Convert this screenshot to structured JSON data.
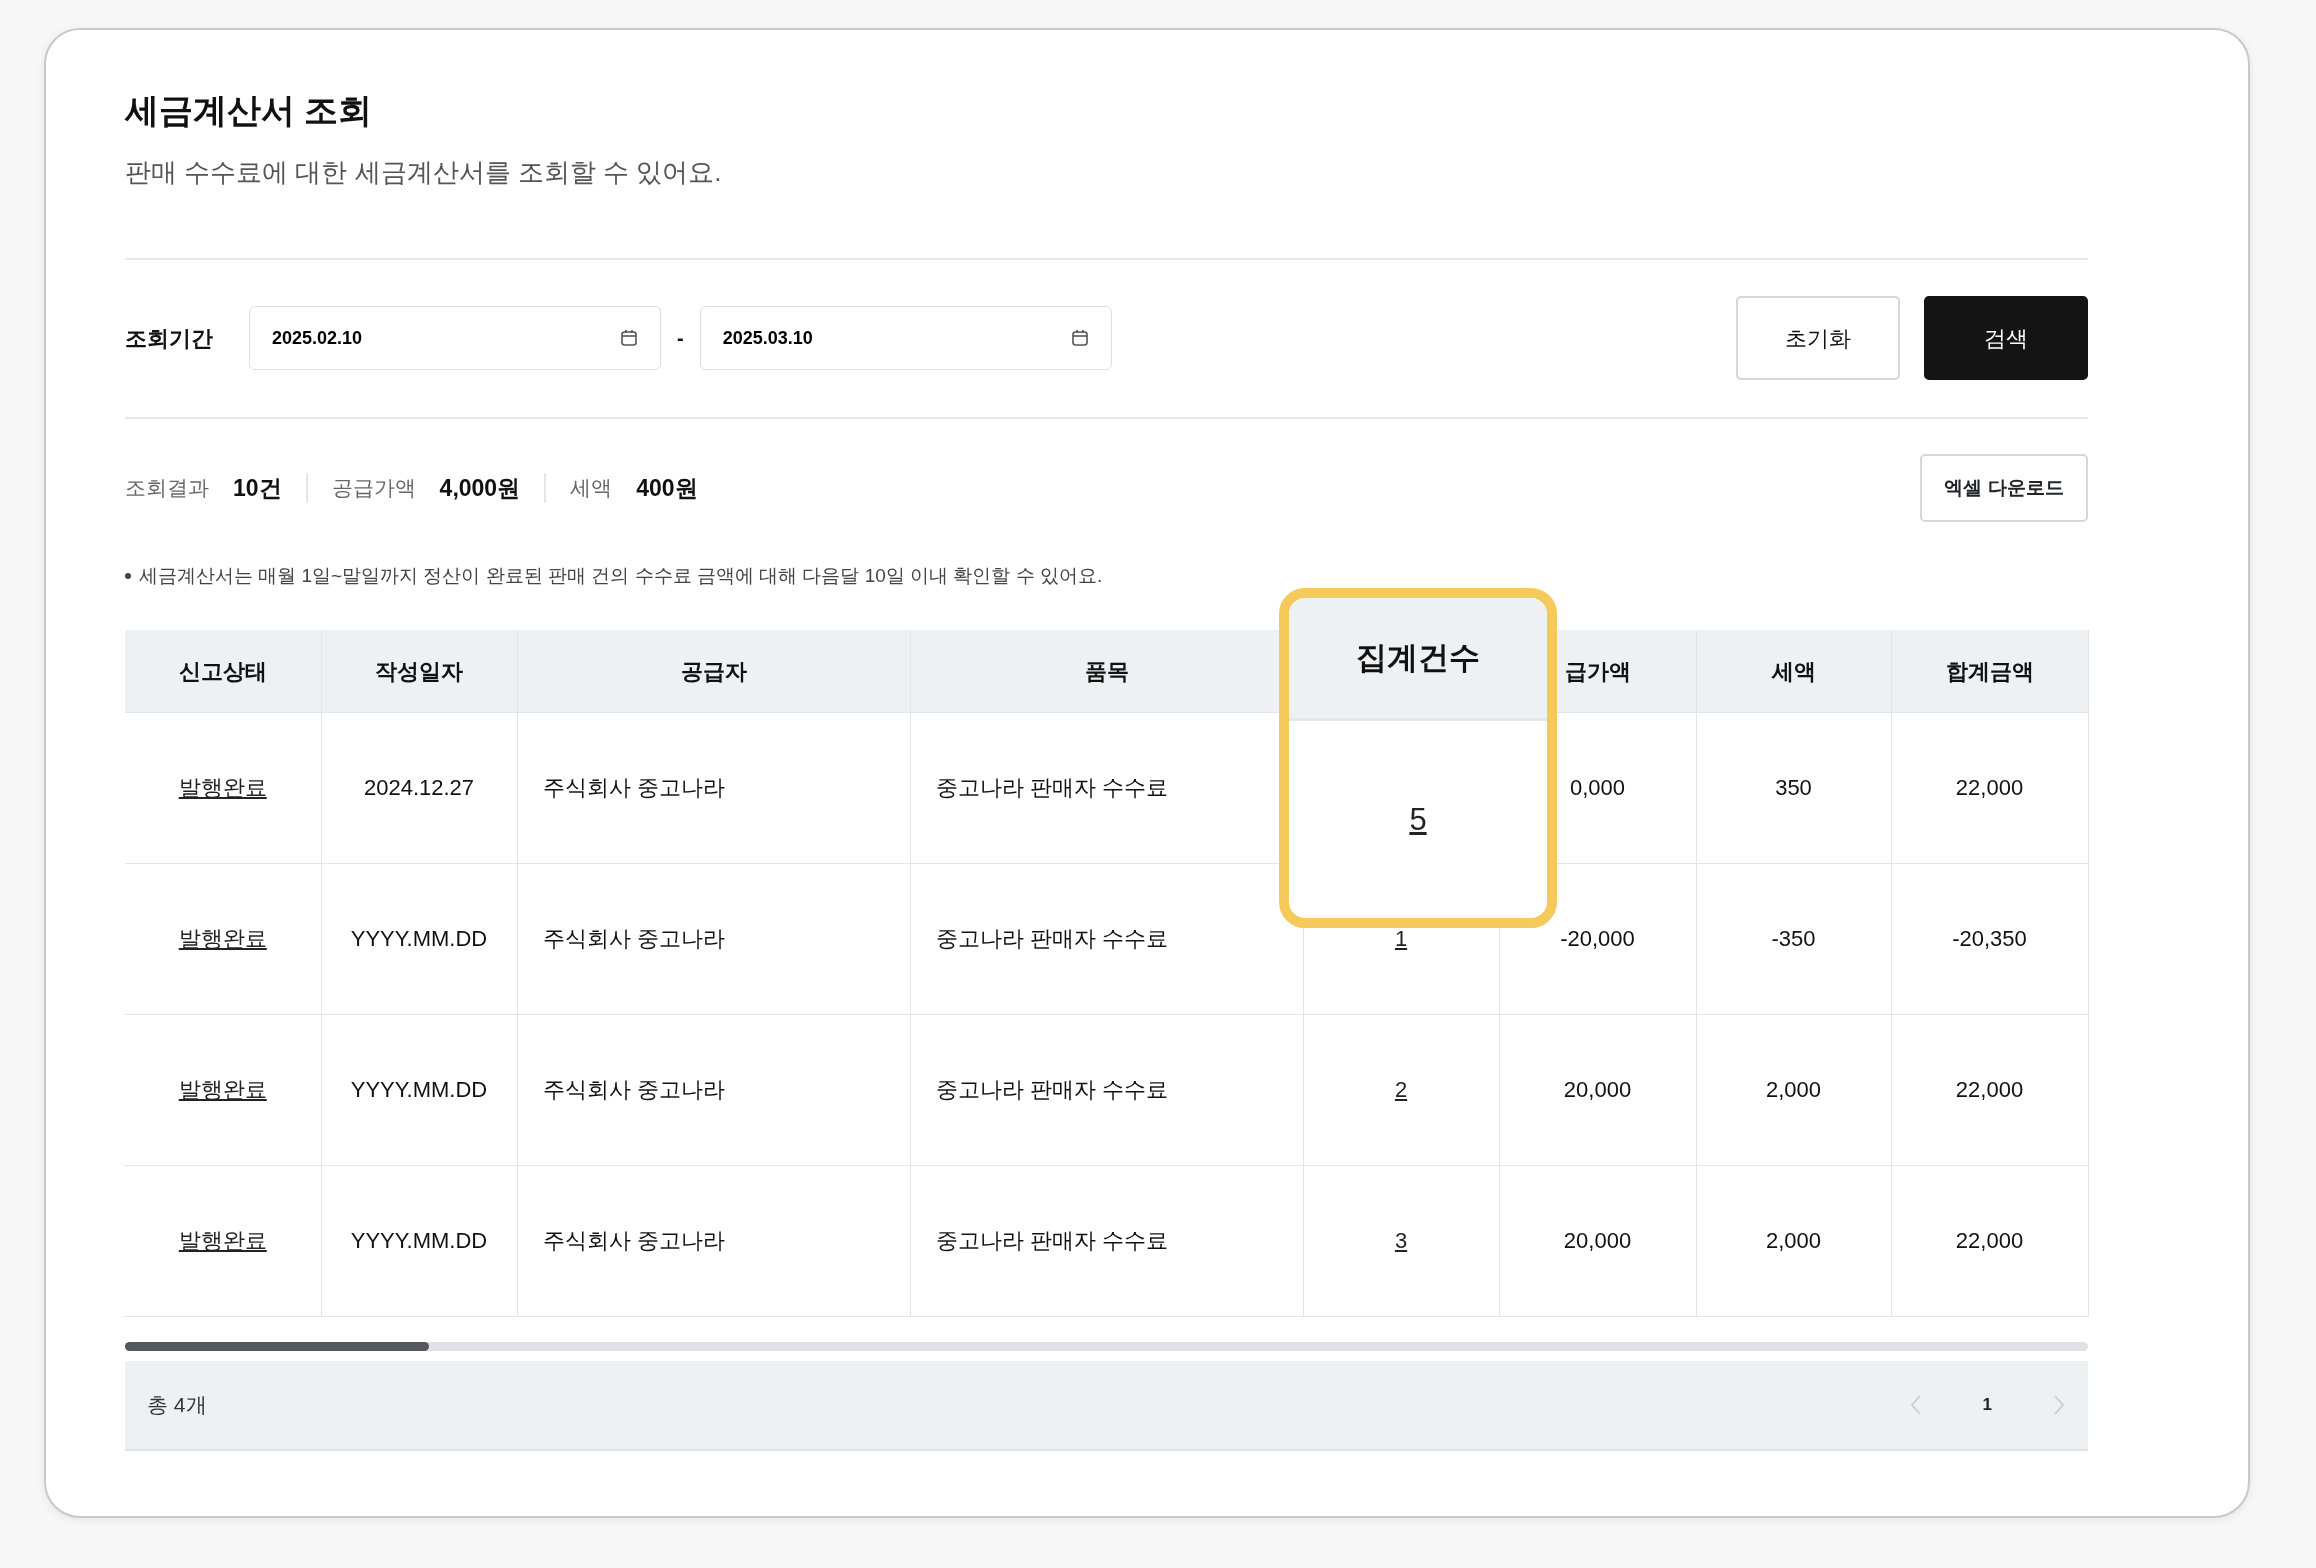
{
  "title": "세금계산서 조회",
  "subtitle": "판매 수수료에 대한 세금계산서를 조회할 수 있어요.",
  "filter": {
    "label": "조회기간",
    "start": "2025.02.10",
    "separator": "-",
    "end": "2025.03.10",
    "buttons": [
      {
        "label": "초기화",
        "kind": "outline"
      },
      {
        "label": "검색",
        "kind": "primary"
      }
    ]
  },
  "summary": [
    {
      "label": "조회결과",
      "value": "10건"
    },
    {
      "label": "공급가액",
      "value": "4,000원"
    },
    {
      "label": "세액",
      "value": "400원"
    }
  ],
  "excel_button": "엑셀 다운로드",
  "note": "세금계산서는 매월 1일~말일까지 정산이 완료된 판매 건의 수수료 금액에 대해 다음달 10일 이내 확인할 수 있어요.",
  "table": {
    "columns": [
      {
        "label": "신고상태"
      },
      {
        "label": "작성일자"
      },
      {
        "label": "공급자"
      },
      {
        "label": "품목"
      },
      {},
      {
        "label": "급가액"
      },
      {
        "label": "세액"
      },
      {
        "label": "합계금액"
      }
    ],
    "rows": [
      {
        "status": "발행완료",
        "date": "2024.12.27",
        "supplier": "주식회사 중고나라",
        "item": "중고나라 판매자 수수료",
        "supply": "0,000",
        "tax": "350",
        "total": "22,000"
      },
      {
        "status": "발행완료",
        "date": "YYYY.MM.DD",
        "supplier": "주식회사 중고나라",
        "item": "중고나라 판매자 수수료",
        "count": "1",
        "supply": "-20,000",
        "tax": "-350",
        "total": "-20,350"
      },
      {
        "status": "발행완료",
        "date": "YYYY.MM.DD",
        "supplier": "주식회사 중고나라",
        "item": "중고나라 판매자 수수료",
        "count": "2",
        "supply": "20,000",
        "tax": "2,000",
        "total": "22,000"
      },
      {
        "status": "발행완료",
        "date": "YYYY.MM.DD",
        "supplier": "주식회사 중고나라",
        "item": "중고나라 판매자 수수료",
        "count": "3",
        "supply": "20,000",
        "tax": "2,000",
        "total": "22,000"
      }
    ]
  },
  "callout": {
    "header": "집계건수",
    "value": "5"
  },
  "footer": {
    "total": "총 4개",
    "pages": [
      {
        "label": "1",
        "selected": true
      }
    ]
  }
}
